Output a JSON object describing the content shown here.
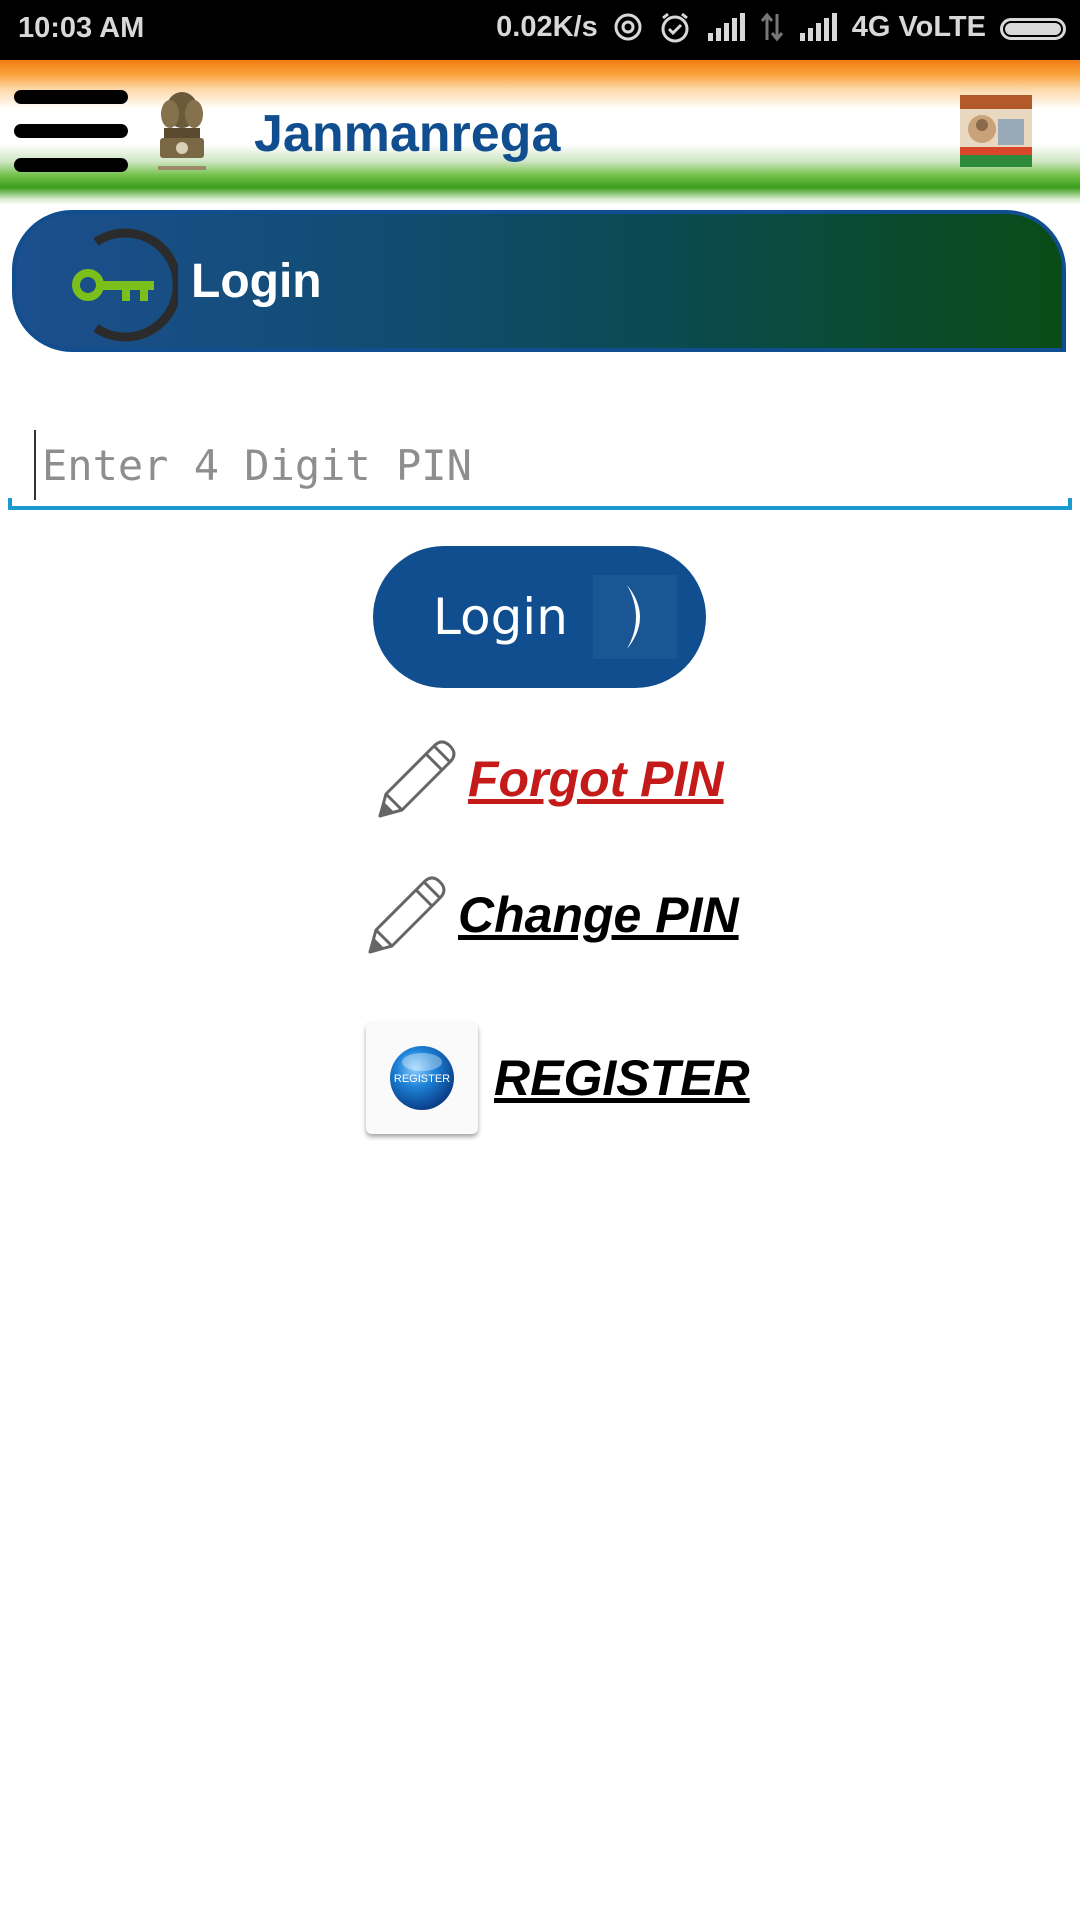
{
  "status_bar": {
    "time": "10:03 AM",
    "net_speed": "0.02K/s",
    "network": "4G VoLTE"
  },
  "header": {
    "title": "Janmanrega"
  },
  "banner": {
    "title": "Login"
  },
  "pin_field": {
    "placeholder": "Enter 4 Digit PIN",
    "value": ""
  },
  "login_button": {
    "label": "Login"
  },
  "links": {
    "forgot_pin": "Forgot PIN",
    "change_pin": "Change PIN",
    "register": "REGISTER",
    "register_icon_text": "REGISTER"
  },
  "colors": {
    "brand_blue": "#114e8f",
    "forgot_red": "#c51a1a",
    "input_underline": "#1a9bd0"
  },
  "icons": [
    "menu-icon",
    "emblem-icon",
    "profile-icon",
    "key-icon",
    "chevron-right-icon",
    "pencil-icon",
    "register-icon"
  ]
}
